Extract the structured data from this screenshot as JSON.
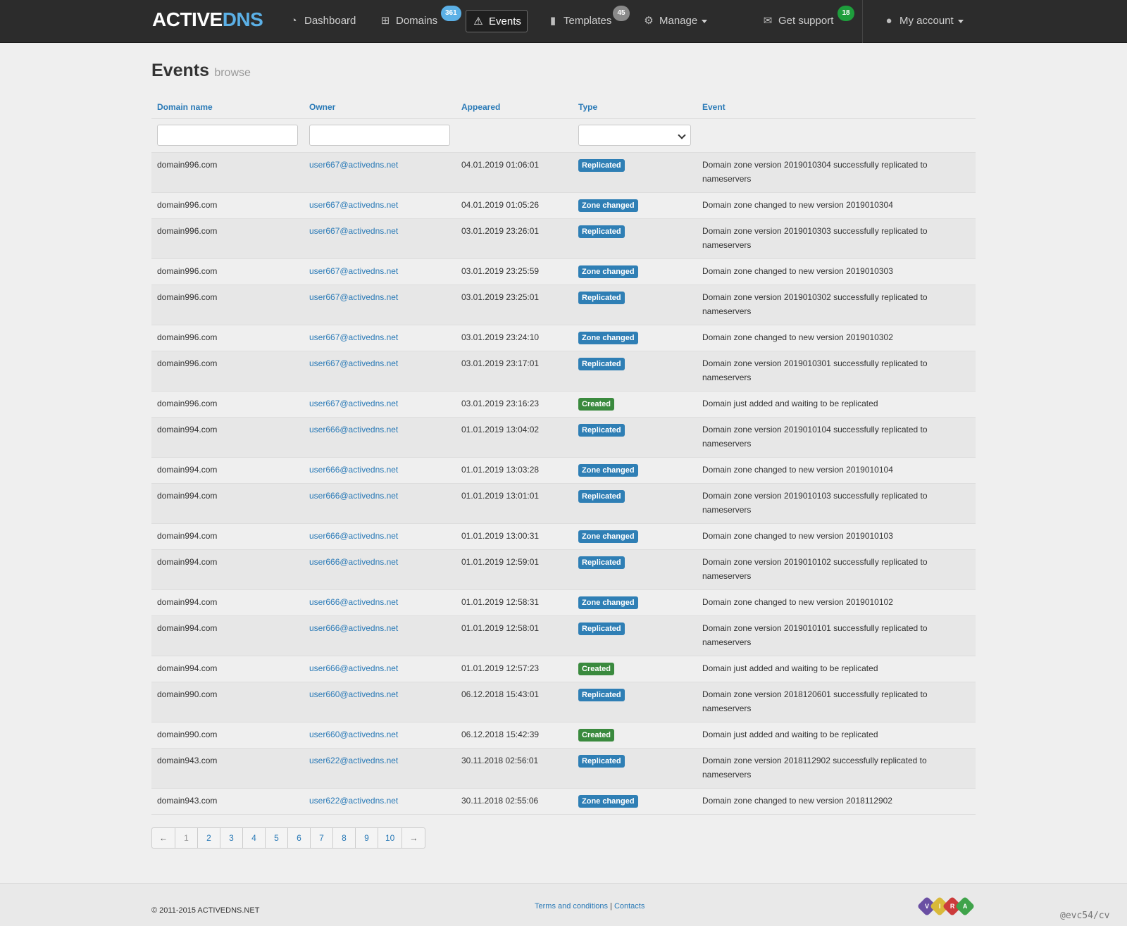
{
  "nav": {
    "brand_active": "ACTIVE",
    "brand_dns": "DNS",
    "dashboard": "Dashboard",
    "domains": "Domains",
    "domains_badge": "361",
    "events": "Events",
    "templates": "Templates",
    "templates_badge": "45",
    "manage": "Manage",
    "support": "Get support",
    "support_badge": "18",
    "account": "My account"
  },
  "page": {
    "title": "Events",
    "subtitle": "browse"
  },
  "table": {
    "headers": [
      "Domain name",
      "Owner",
      "Appeared",
      "Type",
      "Event"
    ],
    "rows": [
      {
        "domain": "domain996.com",
        "owner": "user667@activedns.net",
        "time": "04.01.2019 01:06:01",
        "type": "Replicated",
        "event": "Domain zone version 2019010304 successfully replicated to nameservers"
      },
      {
        "domain": "domain996.com",
        "owner": "user667@activedns.net",
        "time": "04.01.2019 01:05:26",
        "type": "Zone changed",
        "event": "Domain zone changed to new version 2019010304"
      },
      {
        "domain": "domain996.com",
        "owner": "user667@activedns.net",
        "time": "03.01.2019 23:26:01",
        "type": "Replicated",
        "event": "Domain zone version 2019010303 successfully replicated to nameservers"
      },
      {
        "domain": "domain996.com",
        "owner": "user667@activedns.net",
        "time": "03.01.2019 23:25:59",
        "type": "Zone changed",
        "event": "Domain zone changed to new version 2019010303"
      },
      {
        "domain": "domain996.com",
        "owner": "user667@activedns.net",
        "time": "03.01.2019 23:25:01",
        "type": "Replicated",
        "event": "Domain zone version 2019010302 successfully replicated to nameservers"
      },
      {
        "domain": "domain996.com",
        "owner": "user667@activedns.net",
        "time": "03.01.2019 23:24:10",
        "type": "Zone changed",
        "event": "Domain zone changed to new version 2019010302"
      },
      {
        "domain": "domain996.com",
        "owner": "user667@activedns.net",
        "time": "03.01.2019 23:17:01",
        "type": "Replicated",
        "event": "Domain zone version 2019010301 successfully replicated to nameservers"
      },
      {
        "domain": "domain996.com",
        "owner": "user667@activedns.net",
        "time": "03.01.2019 23:16:23",
        "type": "Created",
        "event": "Domain just added and waiting to be replicated"
      },
      {
        "domain": "domain994.com",
        "owner": "user666@activedns.net",
        "time": "01.01.2019 13:04:02",
        "type": "Replicated",
        "event": "Domain zone version 2019010104 successfully replicated to nameservers"
      },
      {
        "domain": "domain994.com",
        "owner": "user666@activedns.net",
        "time": "01.01.2019 13:03:28",
        "type": "Zone changed",
        "event": "Domain zone changed to new version 2019010104"
      },
      {
        "domain": "domain994.com",
        "owner": "user666@activedns.net",
        "time": "01.01.2019 13:01:01",
        "type": "Replicated",
        "event": "Domain zone version 2019010103 successfully replicated to nameservers"
      },
      {
        "domain": "domain994.com",
        "owner": "user666@activedns.net",
        "time": "01.01.2019 13:00:31",
        "type": "Zone changed",
        "event": "Domain zone changed to new version 2019010103"
      },
      {
        "domain": "domain994.com",
        "owner": "user666@activedns.net",
        "time": "01.01.2019 12:59:01",
        "type": "Replicated",
        "event": "Domain zone version 2019010102 successfully replicated to nameservers"
      },
      {
        "domain": "domain994.com",
        "owner": "user666@activedns.net",
        "time": "01.01.2019 12:58:31",
        "type": "Zone changed",
        "event": "Domain zone changed to new version 2019010102"
      },
      {
        "domain": "domain994.com",
        "owner": "user666@activedns.net",
        "time": "01.01.2019 12:58:01",
        "type": "Replicated",
        "event": "Domain zone version 2019010101 successfully replicated to nameservers"
      },
      {
        "domain": "domain994.com",
        "owner": "user666@activedns.net",
        "time": "01.01.2019 12:57:23",
        "type": "Created",
        "event": "Domain just added and waiting to be replicated"
      },
      {
        "domain": "domain990.com",
        "owner": "user660@activedns.net",
        "time": "06.12.2018 15:43:01",
        "type": "Replicated",
        "event": "Domain zone version 2018120601 successfully replicated to nameservers"
      },
      {
        "domain": "domain990.com",
        "owner": "user660@activedns.net",
        "time": "06.12.2018 15:42:39",
        "type": "Created",
        "event": "Domain just added and waiting to be replicated"
      },
      {
        "domain": "domain943.com",
        "owner": "user622@activedns.net",
        "time": "30.11.2018 02:56:01",
        "type": "Replicated",
        "event": "Domain zone version 2018112902 successfully replicated to nameservers"
      },
      {
        "domain": "domain943.com",
        "owner": "user622@activedns.net",
        "time": "30.11.2018 02:55:06",
        "type": "Zone changed",
        "event": "Domain zone changed to new version 2018112902"
      }
    ]
  },
  "type_colors": {
    "Replicated": "#2f7fb5",
    "Zone changed": "#2f7fb5",
    "Created": "#3a8a3e"
  },
  "pagination": {
    "prev": "←",
    "pages": [
      "1",
      "2",
      "3",
      "4",
      "5",
      "6",
      "7",
      "8",
      "9",
      "10"
    ],
    "current": "1",
    "next": "→"
  },
  "footer": {
    "copyright": "© 2011-2015 ACTIVEDNS.NET",
    "terms": "Terms and conditions",
    "separator": "|",
    "contacts": "Contacts",
    "vira_letters": [
      "V",
      "I",
      "R",
      "A"
    ],
    "vira_colors": [
      "#6a4fa3",
      "#d9b93a",
      "#cc3b3b",
      "#3fa34a"
    ],
    "signature": "@evc54/cv"
  },
  "colors": {
    "navbar": "#2c2c2c",
    "link": "#2a7ab7",
    "brand_dns": "#5bb0e6",
    "badge_domains": "#5bb0e6",
    "badge_templates": "#8a8a8a",
    "badge_support": "#1e9e3c"
  }
}
